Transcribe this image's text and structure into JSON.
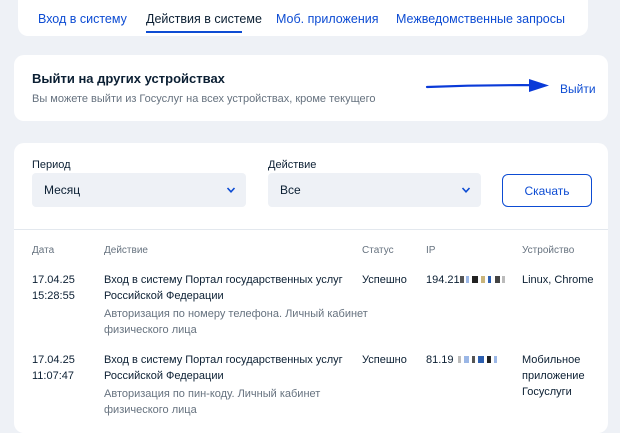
{
  "tabs": [
    {
      "label": "Вход в систему"
    },
    {
      "label": "Действия в системе"
    },
    {
      "label": "Моб. приложения"
    },
    {
      "label": "Межведомственные запросы"
    }
  ],
  "logout": {
    "title": "Выйти на других устройствах",
    "description": "Вы можете выйти из Госуслуг на всех устройствах, кроме текущего",
    "link": "Выйти"
  },
  "filters": {
    "period_label": "Период",
    "period_value": "Месяц",
    "action_label": "Действие",
    "action_value": "Все",
    "download_label": "Скачать"
  },
  "table": {
    "headers": {
      "date": "Дата",
      "action": "Действие",
      "status": "Статус",
      "ip": "IP",
      "device": "Устройство"
    },
    "rows": [
      {
        "date": "17.04.25",
        "time": "15:28:55",
        "action_line1": "Вход в систему Портал государственных услуг",
        "action_line2": "Российской Федерации",
        "detail_line1": "Авторизация по номеру телефона. Личный кабинет",
        "detail_line2": "физического лица",
        "status": "Успешно",
        "ip": "194.21",
        "device_line1": "Linux, Chrome"
      },
      {
        "date": "17.04.25",
        "time": "11:07:47",
        "action_line1": "Вход в систему Портал государственных услуг",
        "action_line2": "Российской Федерации",
        "detail_line1": "Авторизация по пин-коду. Личный кабинет",
        "detail_line2": "физического лица",
        "status": "Успешно",
        "ip": "81.19",
        "device_line1": "Мобильное",
        "device_line2": "приложение",
        "device_line3": "Госуслуги"
      }
    ]
  }
}
